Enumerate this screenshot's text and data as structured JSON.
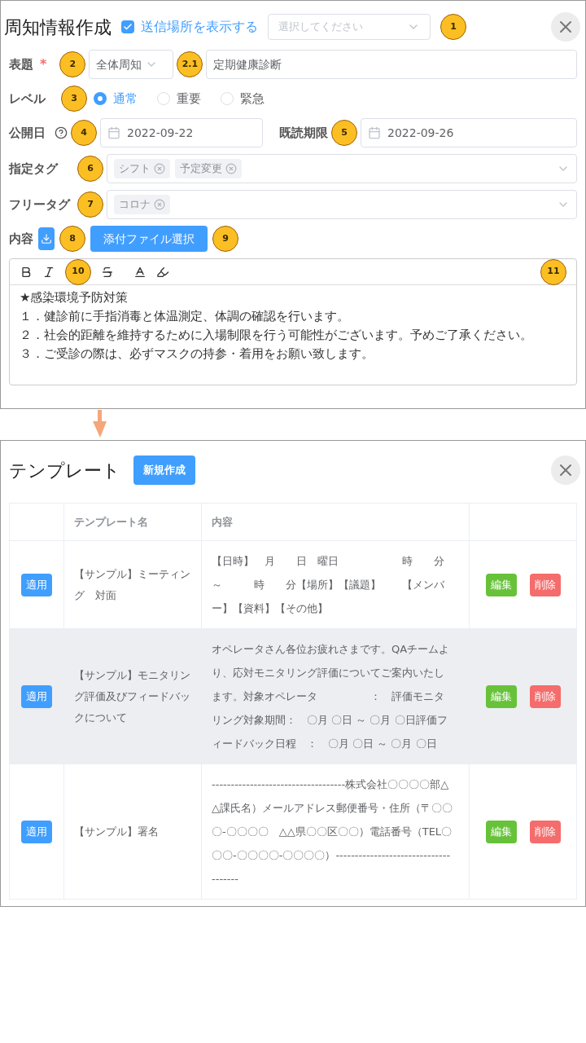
{
  "compose": {
    "title": "周知情報作成",
    "show_location": {
      "label": "送信場所を表示する",
      "checked": true
    },
    "location_select": {
      "placeholder": "選択してください",
      "badge": "1"
    },
    "subject": {
      "label": "表題",
      "required": true,
      "required_mark": "*",
      "category": "全体周知",
      "value": "定期健康診断",
      "badge": "2",
      "value_badge": "2.1"
    },
    "level": {
      "label": "レベル",
      "badge": "3",
      "options": [
        {
          "label": "通常",
          "selected": true
        },
        {
          "label": "重要",
          "selected": false
        },
        {
          "label": "緊急",
          "selected": false
        }
      ]
    },
    "publish_date": {
      "label": "公開日",
      "value": "2022-09-22",
      "badge": "4"
    },
    "read_deadline": {
      "label": "既読期限",
      "value": "2022-09-26",
      "badge": "5"
    },
    "tags": {
      "label": "指定タグ",
      "badge": "6",
      "items": [
        "シフト",
        "予定変更"
      ]
    },
    "free_tags": {
      "label": "フリータグ",
      "badge": "7",
      "items": [
        "コロナ"
      ]
    },
    "content": {
      "label": "内容",
      "download_badge": "8",
      "attach_button": "添付ファイル選択",
      "attach_badge": "9",
      "toolbar_badge": "10",
      "editor_badge": "11",
      "lines": [
        "★感染環境予防対策",
        "１．健診前に手指消毒と体温測定、体調の確認を行います。",
        "２．社会的距離を維持するために入場制限を行う可能性がございます。予めご了承ください。",
        "３．ご受診の際は、必ずマスクの持参・着用をお願い致します。"
      ]
    }
  },
  "templates": {
    "title": "テンプレート",
    "new_button": "新規作成",
    "columns": [
      "テンプレート名",
      "内容"
    ],
    "rows": [
      {
        "apply": "適用",
        "name": "【サンプル】ミーティング　対面",
        "content": "【日時】　月　　日　曜日　　　　　　時　　分～　　　時　　分【場所】【議題】　　【メンバー】【資料】【その他】",
        "edit": "編集",
        "delete": "削除",
        "highlighted": false
      },
      {
        "apply": "適用",
        "name": "【サンプル】モニタリング評価及びフィードバックについて",
        "content": "オペレータさん各位お疲れさまです。QAチームより、応対モニタリング評価についてご案内いたします。対象オペレータ　　　　　：　評価モニタリング対象期間：　〇月 〇日 ～ 〇月 〇日評価フィードバック日程　：　〇月 〇日 ～ 〇月 〇日",
        "edit": "編集",
        "delete": "削除",
        "highlighted": true
      },
      {
        "apply": "適用",
        "name": "【サンプル】署名",
        "content": "-----------------------------------株式会社〇〇〇〇部△△課氏名）メールアドレス郵便番号・住所（〒〇〇〇-〇〇〇〇　△△県〇〇区〇〇）電話番号（TEL〇〇〇-〇〇〇〇-〇〇〇〇）-------------------------------------",
        "edit": "編集",
        "delete": "削除",
        "highlighted": false
      }
    ]
  }
}
